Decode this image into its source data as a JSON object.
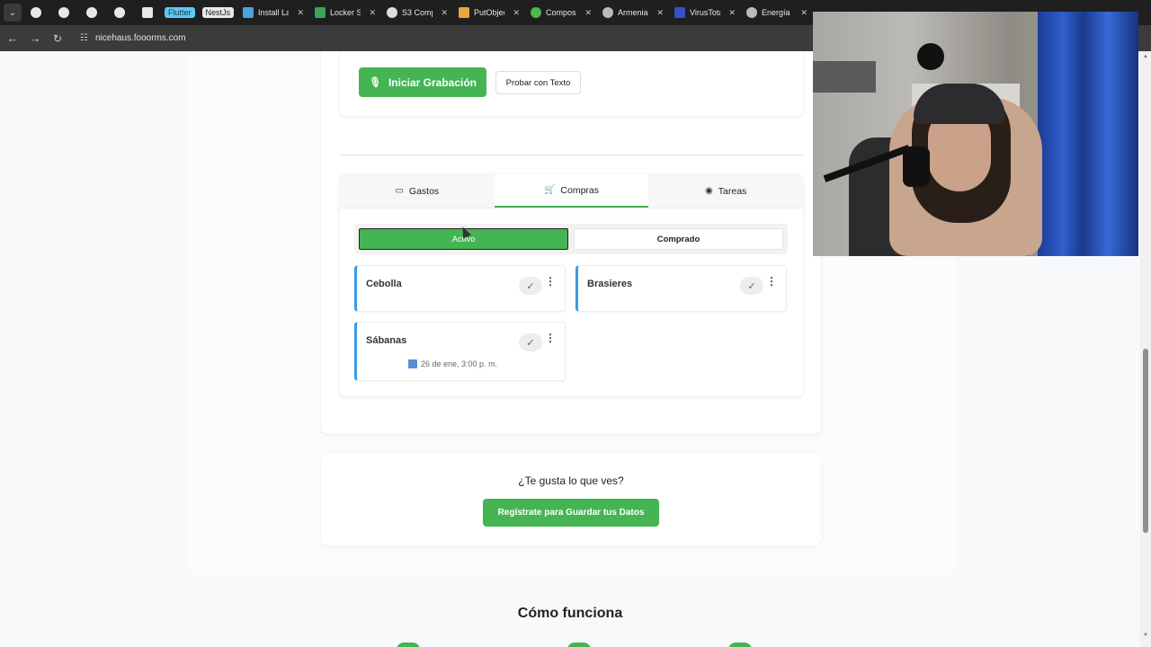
{
  "browser": {
    "pinned_tabs": [
      {
        "icon": "github-icon"
      },
      {
        "icon": "github-icon"
      },
      {
        "icon": "github-icon"
      },
      {
        "icon": "github-icon"
      },
      {
        "icon": "news-icon"
      },
      {
        "label": "Flutter",
        "color": "#5ec8f2"
      },
      {
        "label": "NestJs",
        "color": "#e8e8e8"
      }
    ],
    "tabs": [
      {
        "title": "Install La",
        "icon": "x-icon"
      },
      {
        "title": "Locker S",
        "icon": "shield-icon"
      },
      {
        "title": "S3 Comp",
        "icon": "bolt-icon"
      },
      {
        "title": "PutObjec",
        "icon": "box-icon"
      },
      {
        "title": "Compos",
        "icon": "puzzle-icon"
      },
      {
        "title": "Armenia",
        "icon": "globe-icon"
      },
      {
        "title": "VirusTota",
        "icon": "virustotal-icon"
      },
      {
        "title": "Energía",
        "icon": "globe-icon"
      }
    ],
    "url": "nicehaus.fooorms.com"
  },
  "recorder": {
    "record_label": "Iniciar Grabación",
    "text_label": "Probar con Texto"
  },
  "main_tabs": [
    {
      "label": "Gastos",
      "icon": "money-icon",
      "active": false
    },
    {
      "label": "Compras",
      "icon": "cart-icon",
      "active": true
    },
    {
      "label": "Tareas",
      "icon": "check-circle-icon",
      "active": false
    }
  ],
  "filter": {
    "active_label": "Activo",
    "bought_label": "Comprado"
  },
  "items": [
    {
      "name": "Cebolla",
      "check": "✓"
    },
    {
      "name": "Brasieres",
      "check": "✓"
    },
    {
      "name": "Sábanas",
      "check": "✓",
      "date": "26 de ene, 3:00 p. m."
    }
  ],
  "cta": {
    "question": "¿Te gusta lo que ves?",
    "button": "Regístrate para Guardar tus Datos"
  },
  "how_title": "Cómo funciona",
  "colors": {
    "accent_green": "#45b453",
    "item_border_blue": "#3b9be6"
  }
}
